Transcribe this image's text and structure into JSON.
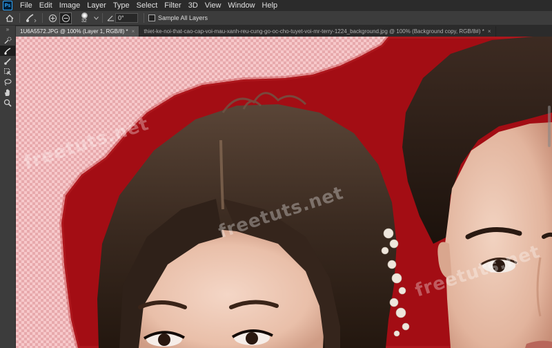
{
  "app": {
    "logo_text": "Ps"
  },
  "menu": [
    "File",
    "Edit",
    "Image",
    "Layer",
    "Type",
    "Select",
    "Filter",
    "3D",
    "View",
    "Window",
    "Help"
  ],
  "options": {
    "brush_size": "32",
    "angle": "0°",
    "sample_all_layers_label": "Sample All Layers",
    "sample_all_layers_checked": false
  },
  "toolbar": {
    "collapse_glyph": "»",
    "tools": [
      "quick-selection-tool",
      "refine-edge-brush-tool",
      "brush-tool",
      "object-selection-tool",
      "lasso-tool",
      "hand-tool",
      "zoom-tool"
    ]
  },
  "tabs": [
    {
      "label": "1U6A5572.JPG @ 100% (Layer 1, RGB/8) *",
      "active": true
    },
    {
      "label": "thiet-ke-noi-that-cao-cap-voi-mau-xanh-reu-cung-go-oc-cho-tuyet-voi-mr-terry-1224_background.jpg @ 100% (Background copy, RGB/8#) *",
      "active": false
    }
  ],
  "tab_close_glyph": "×",
  "canvas": {
    "background_color": "#a30d14",
    "transparency_check_light": "#f7c9cb",
    "transparency_check_dark": "#e7a9ac",
    "watermark_text": "freetuts.net"
  }
}
